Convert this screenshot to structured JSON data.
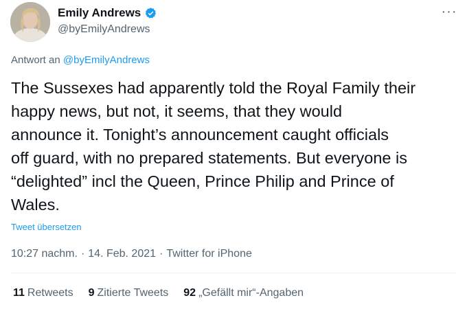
{
  "author": {
    "display_name": "Emily Andrews",
    "handle": "@byEmilyAndrews",
    "verified": true
  },
  "reply": {
    "prefix": "Antwort an",
    "mention": "@byEmilyAndrews"
  },
  "tweet": {
    "text": "The Sussexes had apparently told the Royal Family their\nhappy news, but not, it seems, that they would\nannounce it. Tonight’s announcement caught officials\noff guard, with no prepared statements. But everyone is\n“delighted” incl the Queen, Prince Philip and Prince of\nWales.",
    "translate_label": "Tweet übersetzen"
  },
  "meta": {
    "time": "10:27 nachm.",
    "date": "14. Feb. 2021",
    "source": "Twitter for iPhone",
    "separator": "·"
  },
  "stats": {
    "retweets_count": "11",
    "retweets_label": "Retweets",
    "quotes_count": "9",
    "quotes_label": "Zitierte Tweets",
    "likes_count": "92",
    "likes_label": "„Gefällt mir“-Angaben"
  },
  "icons": {
    "more": "more-icon",
    "verified": "verified-badge-icon"
  },
  "colors": {
    "accent": "#1d9bf0",
    "text": "#0f1419",
    "muted": "#536471"
  }
}
